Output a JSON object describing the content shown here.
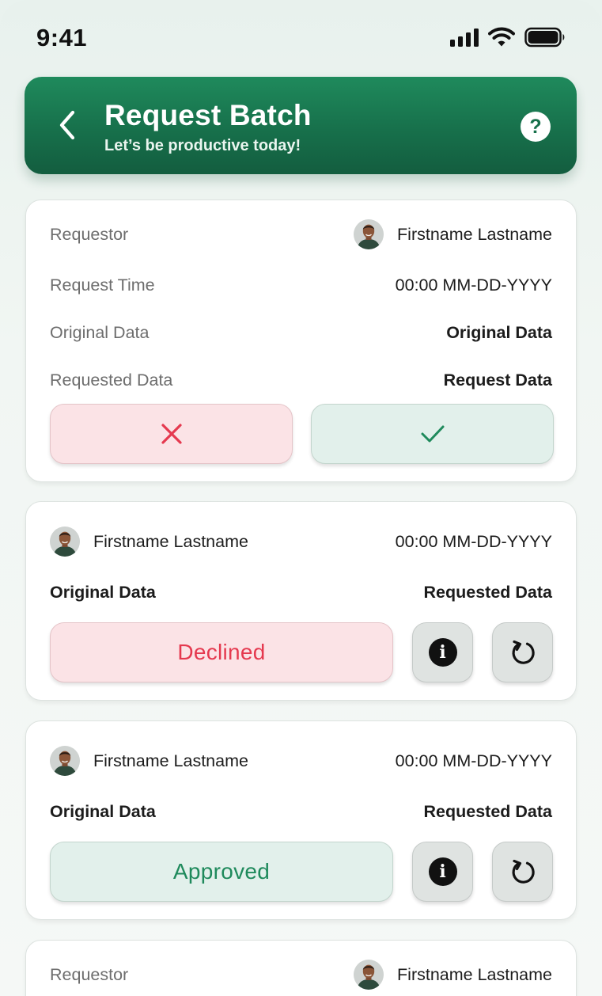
{
  "status_bar": {
    "time": "9:41"
  },
  "header": {
    "title": "Request Batch",
    "subtitle": "Let’s be productive today!",
    "help_label": "?"
  },
  "pending_request": {
    "requestor_label": "Requestor",
    "requestor_name": "Firstname Lastname",
    "time_label": "Request Time",
    "time_value": "00:00 MM-DD-YYYY",
    "original_label": "Original Data",
    "original_value": "Original Data",
    "requested_label": "Requested Data",
    "requested_value": "Request Data",
    "colors": {
      "decline": "#e5394f",
      "approve": "#1f8a5c"
    }
  },
  "history": [
    {
      "name": "Firstname Lastname",
      "time": "00:00 MM-DD-YYYY",
      "original": "Original Data",
      "requested": "Requested Data",
      "status": "Declined"
    },
    {
      "name": "Firstname Lastname",
      "time": "00:00 MM-DD-YYYY",
      "original": "Original Data",
      "requested": "Requested Data",
      "status": "Approved"
    }
  ],
  "partial_request": {
    "requestor_label": "Requestor",
    "requestor_name": "Firstname Lastname"
  },
  "icons": {
    "back": "chevron-left-icon",
    "help": "question-icon",
    "decline": "x-icon",
    "approve": "check-icon",
    "info": "info-icon",
    "revert": "undo-icon"
  }
}
